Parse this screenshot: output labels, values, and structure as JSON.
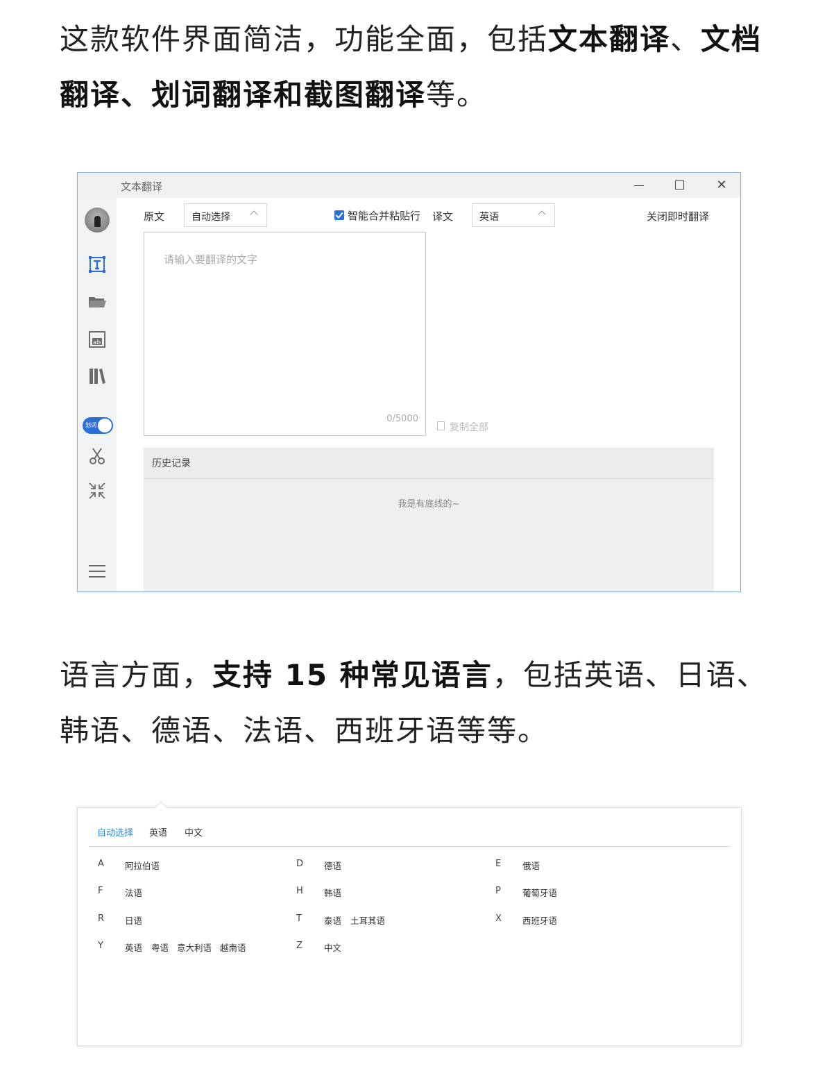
{
  "paragraph1": {
    "part1": "这款软件界面简洁，功能全面，包括",
    "bold1": "文本翻译",
    "part2": "、",
    "bold2": "文档翻译、划词翻译和截图翻译",
    "part3": "等。"
  },
  "paragraph2": {
    "part1": "语言方面，",
    "bold1": "支持 15 种常见语言",
    "part2": "，包括英语、日语、韩语、德语、法语、西班牙语等等。"
  },
  "window1": {
    "title": "文本翻译",
    "source_label": "原文",
    "source_lang": "自动选择",
    "smart_merge_label": "智能合并粘贴行",
    "target_label": "译文",
    "target_lang": "英语",
    "instant_toggle": "关闭即时翻译",
    "input_placeholder": "请输入要翻译的文字",
    "char_counter": "0/5000",
    "copy_all": "复制全部",
    "toggle_label": "划词",
    "history_title": "历史记录",
    "history_empty": "我是有底线的~",
    "sidebar_icons": [
      "avatar",
      "text-translate-icon",
      "folder-icon",
      "ocr-icon",
      "library-icon",
      "word-toggle",
      "scissors-icon",
      "collapse-icon",
      "menu-icon"
    ]
  },
  "window2": {
    "tabs": [
      "自动选择",
      "英语",
      "中文"
    ],
    "groups": [
      {
        "letter": "A",
        "langs": [
          "阿拉伯语"
        ]
      },
      {
        "letter": "D",
        "langs": [
          "德语"
        ]
      },
      {
        "letter": "E",
        "langs": [
          "俄语"
        ]
      },
      {
        "letter": "F",
        "langs": [
          "法语"
        ]
      },
      {
        "letter": "H",
        "langs": [
          "韩语"
        ]
      },
      {
        "letter": "P",
        "langs": [
          "葡萄牙语"
        ]
      },
      {
        "letter": "R",
        "langs": [
          "日语"
        ]
      },
      {
        "letter": "T",
        "langs": [
          "泰语",
          "土耳其语"
        ]
      },
      {
        "letter": "X",
        "langs": [
          "西班牙语"
        ]
      },
      {
        "letter": "Y",
        "langs": [
          "英语",
          "粤语",
          "意大利语",
          "越南语"
        ]
      },
      {
        "letter": "Z",
        "langs": [
          "中文"
        ]
      }
    ]
  },
  "colors": {
    "accent": "#2b6fd6",
    "link": "#2b88d8",
    "window_border": "#8fb3d9"
  }
}
